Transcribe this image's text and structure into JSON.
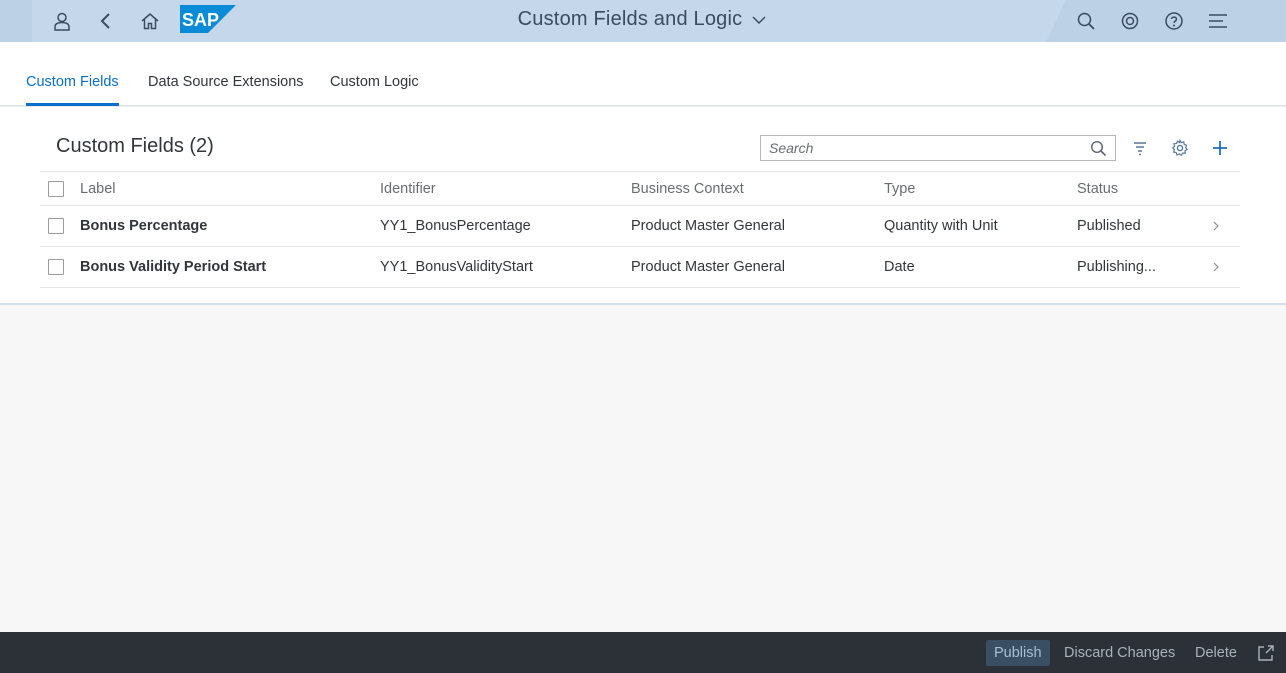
{
  "shell": {
    "title": "Custom Fields and Logic",
    "icons": {
      "user": "user-icon",
      "back": "back-icon",
      "home": "home-icon",
      "logo": "sap-logo",
      "search": "search-icon",
      "co_pilot": "co-pilot-icon",
      "help": "help-icon",
      "notifications": "menu-icon"
    },
    "logo_text": "SAP"
  },
  "tabs": [
    {
      "label": "Custom Fields",
      "active": true
    },
    {
      "label": "Data Source Extensions",
      "active": false
    },
    {
      "label": "Custom Logic",
      "active": false
    }
  ],
  "list": {
    "title": "Custom Fields (2)",
    "search_placeholder": "Search",
    "columns": [
      "Label",
      "Identifier",
      "Business Context",
      "Type",
      "Status"
    ],
    "rows": [
      {
        "label": "Bonus Percentage",
        "identifier": "YY1_BonusPercentage",
        "business_context": "Product Master General",
        "type": "Quantity with Unit",
        "status": "Published"
      },
      {
        "label": "Bonus Validity Period Start",
        "identifier": "YY1_BonusValidityStart",
        "business_context": "Product Master General",
        "type": "Date",
        "status": "Publishing..."
      }
    ]
  },
  "footer": {
    "publish": "Publish",
    "discard": "Discard Changes",
    "delete": "Delete"
  },
  "colors": {
    "accent": "#0a6ed1",
    "shell": "#c5d7ea",
    "published": "#2b7d2b",
    "footer": "#2c3138"
  }
}
